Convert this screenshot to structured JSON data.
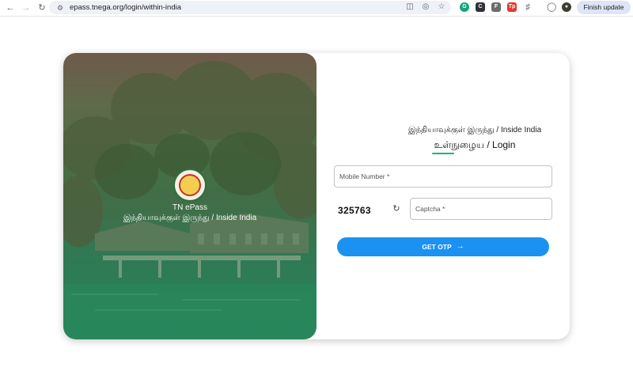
{
  "browser": {
    "url": "epass.tnega.org/login/within-india",
    "finish_update_label": "Finish update",
    "extensions": [
      {
        "name": "grammarly-icon",
        "color": "#15a47b",
        "glyph": "G"
      },
      {
        "name": "ext-dark-icon",
        "color": "#2f3136",
        "glyph": "C"
      },
      {
        "name": "ext-flag-icon",
        "color": "#6c6c6c",
        "glyph": "F"
      },
      {
        "name": "ext-tp-icon",
        "color": "#e03a2d",
        "glyph": "Tp"
      }
    ]
  },
  "hero": {
    "app_name": "TN ePass",
    "subtitle": "இந்தியாவுக்குள் இருந்து / Inside India"
  },
  "form": {
    "subtitle": "இந்தியாவுக்குள் இருந்து / Inside India",
    "title": "உள்நுழைய / Login",
    "mobile_placeholder": "Mobile Number *",
    "captcha_code": "325763",
    "captcha_placeholder": "Captcha *",
    "otp_label": "GET OTP"
  },
  "colors": {
    "accent": "#1b92f2",
    "underline": "#19b38a"
  }
}
